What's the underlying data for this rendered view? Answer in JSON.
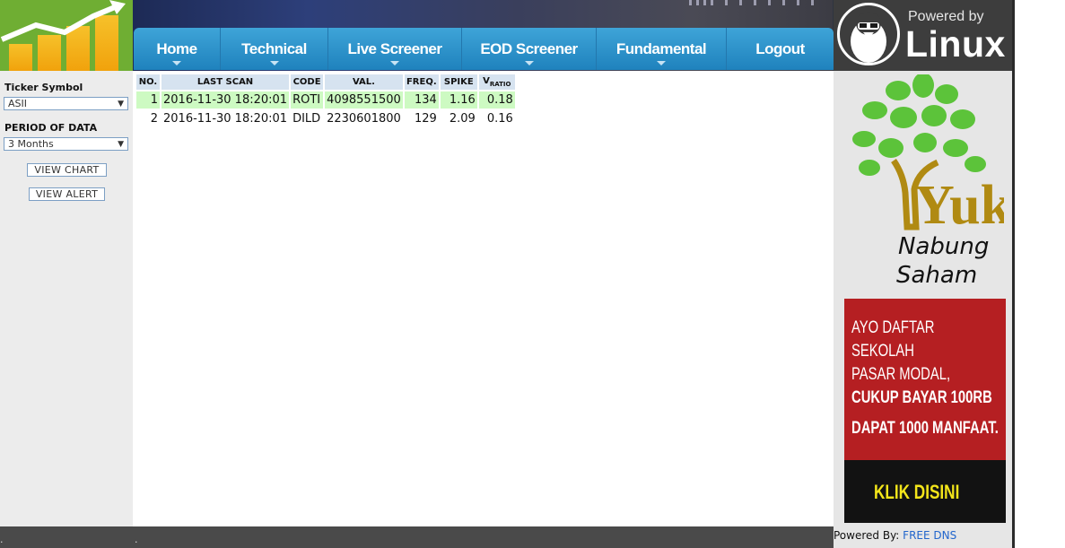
{
  "nav": {
    "items": [
      {
        "label": "Home",
        "dropdown": true
      },
      {
        "label": "Technical",
        "dropdown": true
      },
      {
        "label": "Live Screener",
        "dropdown": true
      },
      {
        "label": "EOD Screener",
        "dropdown": true
      },
      {
        "label": "Fundamental",
        "dropdown": true
      },
      {
        "label": "Logout",
        "dropdown": false
      }
    ]
  },
  "powered": {
    "label": "Powered by",
    "os": "Linux"
  },
  "sidebar": {
    "ticker_label": "Ticker Symbol",
    "ticker_value": "ASII",
    "period_label": "PERIOD OF DATA",
    "period_value": "3 Months",
    "view_chart": "VIEW CHART",
    "view_alert": "VIEW ALERT"
  },
  "table": {
    "headers": {
      "no": "NO.",
      "last_scan": "LAST SCAN",
      "code": "CODE",
      "val": "VAL.",
      "freq": "FREQ.",
      "spike": "SPIKE",
      "vratio_main": "V",
      "vratio_sub": "RATIO"
    },
    "rows": [
      {
        "no": "1",
        "last_scan": "2016-11-30 18:20:01",
        "code": "ROTI",
        "val": "4098551500",
        "freq": "134",
        "spike": "1.16",
        "vratio": "0.18"
      },
      {
        "no": "2",
        "last_scan": "2016-11-30 18:20:01",
        "code": "DILD",
        "val": "2230601800",
        "freq": "129",
        "spike": "2.09",
        "vratio": "0.16"
      }
    ]
  },
  "ads": {
    "tree_line1": "Yuk",
    "tree_line2": "Nabung",
    "tree_line3": "Saham",
    "banner_line1": "AYO DAFTAR SEKOLAH",
    "banner_line2": "PASAR MODAL,",
    "banner_line3": "CUKUP BAYAR 100RB",
    "banner_line4": "DAPAT 1000 MANFAAT.",
    "banner_cta": "KLIK DISINI"
  },
  "footer": {
    "dot_left": ".",
    "dot_mid": ".",
    "powered_by": "Powered By:",
    "dns_link": "FREE DNS"
  },
  "colors": {
    "nav": "#2a92cc",
    "highlight_row": "#cdfac2",
    "banner": "#b51f22",
    "tree": "#5cc33a"
  }
}
